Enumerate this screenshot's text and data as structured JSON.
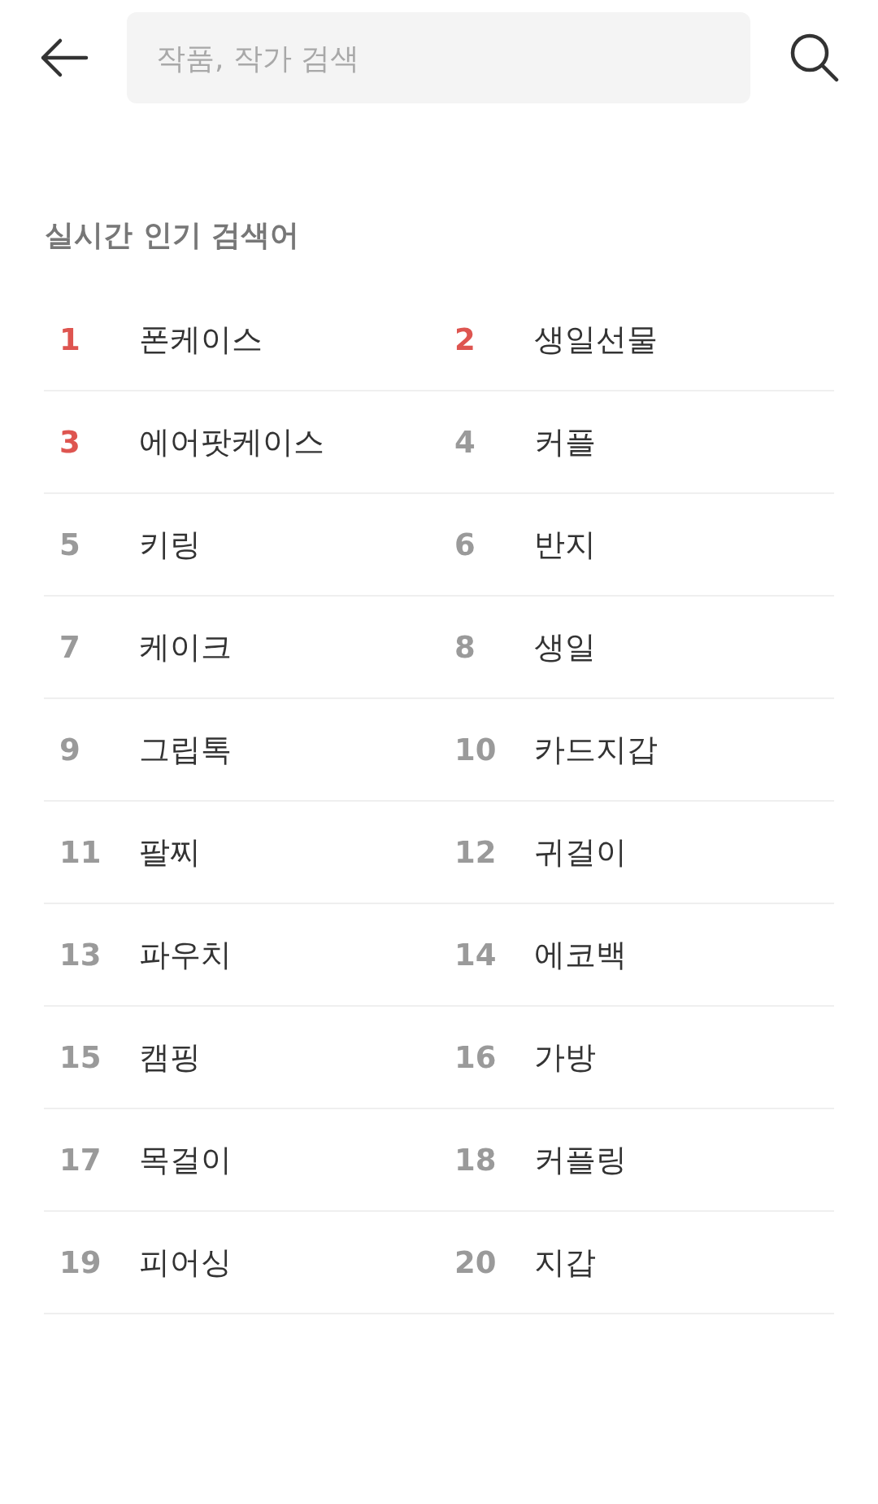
{
  "header": {
    "search": {
      "placeholder": "작품, 작가 검색"
    }
  },
  "trending": {
    "title": "실시간 인기 검색어",
    "items": [
      {
        "rank": "1",
        "term": "폰케이스",
        "highlighted": true
      },
      {
        "rank": "2",
        "term": "생일선물",
        "highlighted": true
      },
      {
        "rank": "3",
        "term": "에어팟케이스",
        "highlighted": true
      },
      {
        "rank": "4",
        "term": "커플",
        "highlighted": false
      },
      {
        "rank": "5",
        "term": "키링",
        "highlighted": false
      },
      {
        "rank": "6",
        "term": "반지",
        "highlighted": false
      },
      {
        "rank": "7",
        "term": "케이크",
        "highlighted": false
      },
      {
        "rank": "8",
        "term": "생일",
        "highlighted": false
      },
      {
        "rank": "9",
        "term": "그립톡",
        "highlighted": false
      },
      {
        "rank": "10",
        "term": "카드지갑",
        "highlighted": false
      },
      {
        "rank": "11",
        "term": "팔찌",
        "highlighted": false
      },
      {
        "rank": "12",
        "term": "귀걸이",
        "highlighted": false
      },
      {
        "rank": "13",
        "term": "파우치",
        "highlighted": false
      },
      {
        "rank": "14",
        "term": "에코백",
        "highlighted": false
      },
      {
        "rank": "15",
        "term": "캠핑",
        "highlighted": false
      },
      {
        "rank": "16",
        "term": "가방",
        "highlighted": false
      },
      {
        "rank": "17",
        "term": "목걸이",
        "highlighted": false
      },
      {
        "rank": "18",
        "term": "커플링",
        "highlighted": false
      },
      {
        "rank": "19",
        "term": "피어싱",
        "highlighted": false
      },
      {
        "rank": "20",
        "term": "지갑",
        "highlighted": false
      }
    ]
  }
}
